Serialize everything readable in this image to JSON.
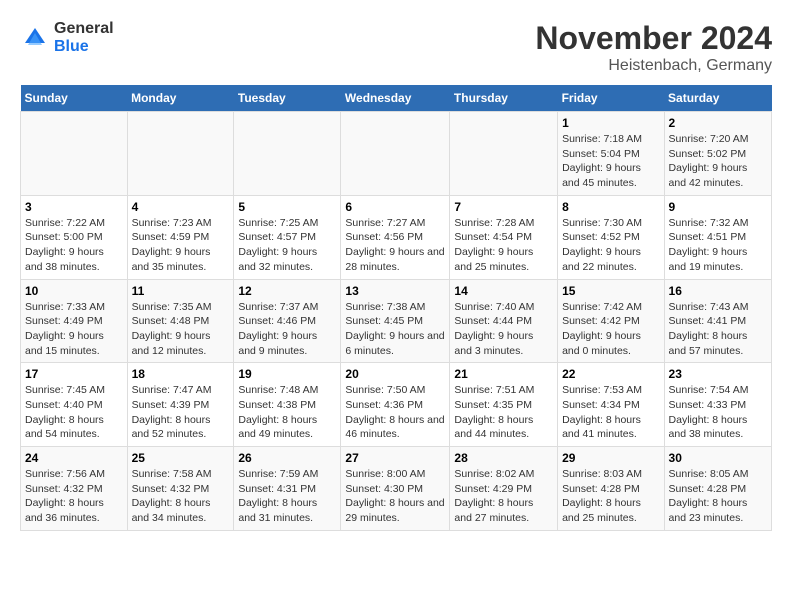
{
  "logo": {
    "general": "General",
    "blue": "Blue"
  },
  "title": "November 2024",
  "location": "Heistenbach, Germany",
  "days_header": [
    "Sunday",
    "Monday",
    "Tuesday",
    "Wednesday",
    "Thursday",
    "Friday",
    "Saturday"
  ],
  "weeks": [
    [
      {
        "day": "",
        "info": ""
      },
      {
        "day": "",
        "info": ""
      },
      {
        "day": "",
        "info": ""
      },
      {
        "day": "",
        "info": ""
      },
      {
        "day": "",
        "info": ""
      },
      {
        "day": "1",
        "info": "Sunrise: 7:18 AM\nSunset: 5:04 PM\nDaylight: 9 hours and 45 minutes."
      },
      {
        "day": "2",
        "info": "Sunrise: 7:20 AM\nSunset: 5:02 PM\nDaylight: 9 hours and 42 minutes."
      }
    ],
    [
      {
        "day": "3",
        "info": "Sunrise: 7:22 AM\nSunset: 5:00 PM\nDaylight: 9 hours and 38 minutes."
      },
      {
        "day": "4",
        "info": "Sunrise: 7:23 AM\nSunset: 4:59 PM\nDaylight: 9 hours and 35 minutes."
      },
      {
        "day": "5",
        "info": "Sunrise: 7:25 AM\nSunset: 4:57 PM\nDaylight: 9 hours and 32 minutes."
      },
      {
        "day": "6",
        "info": "Sunrise: 7:27 AM\nSunset: 4:56 PM\nDaylight: 9 hours and 28 minutes."
      },
      {
        "day": "7",
        "info": "Sunrise: 7:28 AM\nSunset: 4:54 PM\nDaylight: 9 hours and 25 minutes."
      },
      {
        "day": "8",
        "info": "Sunrise: 7:30 AM\nSunset: 4:52 PM\nDaylight: 9 hours and 22 minutes."
      },
      {
        "day": "9",
        "info": "Sunrise: 7:32 AM\nSunset: 4:51 PM\nDaylight: 9 hours and 19 minutes."
      }
    ],
    [
      {
        "day": "10",
        "info": "Sunrise: 7:33 AM\nSunset: 4:49 PM\nDaylight: 9 hours and 15 minutes."
      },
      {
        "day": "11",
        "info": "Sunrise: 7:35 AM\nSunset: 4:48 PM\nDaylight: 9 hours and 12 minutes."
      },
      {
        "day": "12",
        "info": "Sunrise: 7:37 AM\nSunset: 4:46 PM\nDaylight: 9 hours and 9 minutes."
      },
      {
        "day": "13",
        "info": "Sunrise: 7:38 AM\nSunset: 4:45 PM\nDaylight: 9 hours and 6 minutes."
      },
      {
        "day": "14",
        "info": "Sunrise: 7:40 AM\nSunset: 4:44 PM\nDaylight: 9 hours and 3 minutes."
      },
      {
        "day": "15",
        "info": "Sunrise: 7:42 AM\nSunset: 4:42 PM\nDaylight: 9 hours and 0 minutes."
      },
      {
        "day": "16",
        "info": "Sunrise: 7:43 AM\nSunset: 4:41 PM\nDaylight: 8 hours and 57 minutes."
      }
    ],
    [
      {
        "day": "17",
        "info": "Sunrise: 7:45 AM\nSunset: 4:40 PM\nDaylight: 8 hours and 54 minutes."
      },
      {
        "day": "18",
        "info": "Sunrise: 7:47 AM\nSunset: 4:39 PM\nDaylight: 8 hours and 52 minutes."
      },
      {
        "day": "19",
        "info": "Sunrise: 7:48 AM\nSunset: 4:38 PM\nDaylight: 8 hours and 49 minutes."
      },
      {
        "day": "20",
        "info": "Sunrise: 7:50 AM\nSunset: 4:36 PM\nDaylight: 8 hours and 46 minutes."
      },
      {
        "day": "21",
        "info": "Sunrise: 7:51 AM\nSunset: 4:35 PM\nDaylight: 8 hours and 44 minutes."
      },
      {
        "day": "22",
        "info": "Sunrise: 7:53 AM\nSunset: 4:34 PM\nDaylight: 8 hours and 41 minutes."
      },
      {
        "day": "23",
        "info": "Sunrise: 7:54 AM\nSunset: 4:33 PM\nDaylight: 8 hours and 38 minutes."
      }
    ],
    [
      {
        "day": "24",
        "info": "Sunrise: 7:56 AM\nSunset: 4:32 PM\nDaylight: 8 hours and 36 minutes."
      },
      {
        "day": "25",
        "info": "Sunrise: 7:58 AM\nSunset: 4:32 PM\nDaylight: 8 hours and 34 minutes."
      },
      {
        "day": "26",
        "info": "Sunrise: 7:59 AM\nSunset: 4:31 PM\nDaylight: 8 hours and 31 minutes."
      },
      {
        "day": "27",
        "info": "Sunrise: 8:00 AM\nSunset: 4:30 PM\nDaylight: 8 hours and 29 minutes."
      },
      {
        "day": "28",
        "info": "Sunrise: 8:02 AM\nSunset: 4:29 PM\nDaylight: 8 hours and 27 minutes."
      },
      {
        "day": "29",
        "info": "Sunrise: 8:03 AM\nSunset: 4:28 PM\nDaylight: 8 hours and 25 minutes."
      },
      {
        "day": "30",
        "info": "Sunrise: 8:05 AM\nSunset: 4:28 PM\nDaylight: 8 hours and 23 minutes."
      }
    ]
  ]
}
